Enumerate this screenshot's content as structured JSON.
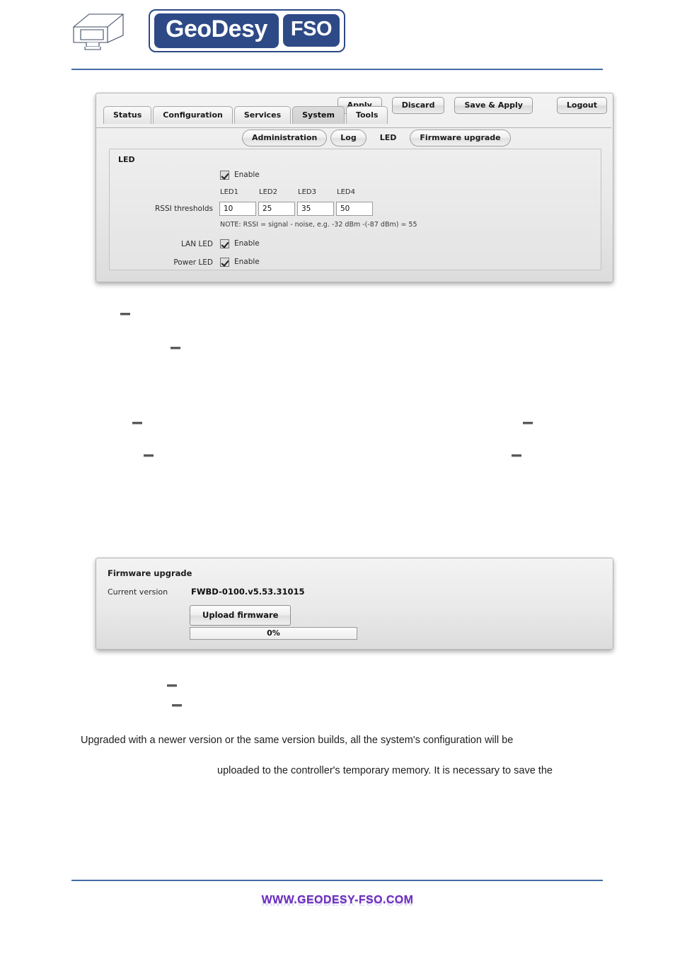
{
  "header": {
    "logo_device_alt": "fso-device-icon",
    "brand_main": "GeoDesy",
    "brand_sub": "FSO"
  },
  "led_screenshot": {
    "top_actions": [
      {
        "label": "Apply",
        "name": "apply-button"
      },
      {
        "label": "Discard",
        "name": "discard-button"
      },
      {
        "label": "Save & Apply",
        "name": "save-and-apply-button"
      },
      {
        "label": "Logout",
        "name": "logout-button"
      }
    ],
    "tabs": [
      {
        "label": "Status",
        "active": false
      },
      {
        "label": "Configuration",
        "active": false
      },
      {
        "label": "Services",
        "active": false
      },
      {
        "label": "System",
        "active": true
      },
      {
        "label": "Tools",
        "active": false
      }
    ],
    "subtabs": [
      {
        "label": "Administration",
        "active": false
      },
      {
        "label": "Log",
        "active": false
      },
      {
        "label": "LED",
        "active": true
      },
      {
        "label": "Firmware upgrade",
        "active": false
      }
    ],
    "box_title": "LED",
    "enable_label": "Enable",
    "rssi_label": "RSSI thresholds",
    "led_columns": [
      "LED1",
      "LED2",
      "LED3",
      "LED4"
    ],
    "rssi_values": [
      "10",
      "25",
      "35",
      "50"
    ],
    "note": "NOTE: RSSI = signal - noise, e.g. -32 dBm -(-87 dBm) = 55",
    "lan_led_label": "LAN LED",
    "lan_led_enable": "Enable",
    "power_led_label": "Power LED",
    "power_led_enable": "Enable"
  },
  "firmware_screenshot": {
    "title": "Firmware upgrade",
    "current_version_label": "Current version",
    "current_version_value": "FWBD-0100.v5.53.31015",
    "upload_button": "Upload firmware",
    "progress_text": "0%"
  },
  "body_text": {
    "line1": "Upgraded with a newer version or the same version builds, all the system's configuration will be",
    "line2": "uploaded to the controller's temporary memory. It is necessary to save the"
  },
  "footer": {
    "url": "WWW.GEODESY-FSO.COM"
  },
  "colors": {
    "brand_blue": "#2e4a86",
    "rule_blue": "#416ca5",
    "footer_purple": "#6b2fbf"
  }
}
